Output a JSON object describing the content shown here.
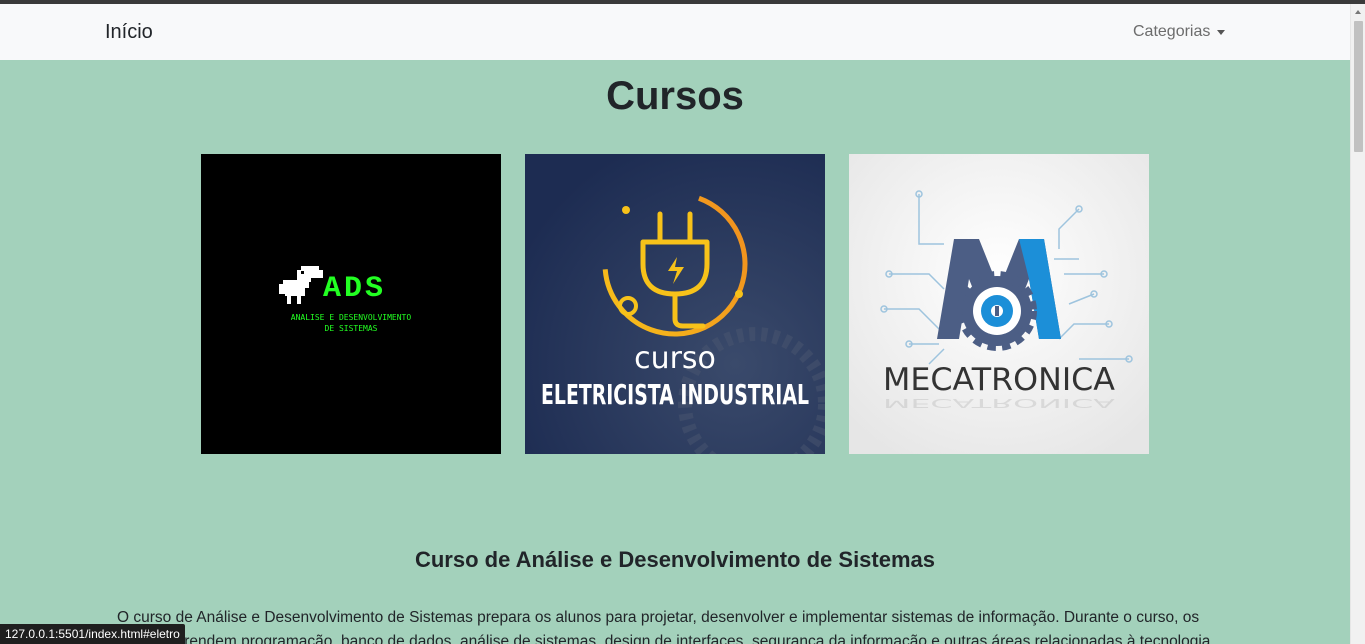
{
  "navbar": {
    "brand": "Início",
    "categories_label": "Categorias"
  },
  "main": {
    "title": "Cursos",
    "courses": [
      {
        "name": "ADS",
        "subtitle_line1": "ANALISE E DESENVOLVIMENTO",
        "subtitle_line2": "DE SISTEMAS",
        "bg": "#000000",
        "accent": "#22ff22"
      },
      {
        "prefix": "curso",
        "name": "ELETRICISTA INDUSTRIAL",
        "bg": "#1f2f57",
        "accent": "#f6b11b"
      },
      {
        "name": "MECATRONICA",
        "bg": "#f3f3f3",
        "accent": "#1a8fd6"
      }
    ],
    "section_title": "Curso de Análise e Desenvolvimento de Sistemas",
    "section_text": "O curso de Análise e Desenvolvimento de Sistemas prepara os alunos para projetar, desenvolver e implementar sistemas de informação. Durante o curso, os alunos aprendem programação, banco de dados, análise de sistemas, design de interfaces, segurança da informação e outras áreas relacionadas à tecnologia"
  },
  "status_bar": {
    "url": "127.0.0.1:5501/index.html#eletro"
  }
}
